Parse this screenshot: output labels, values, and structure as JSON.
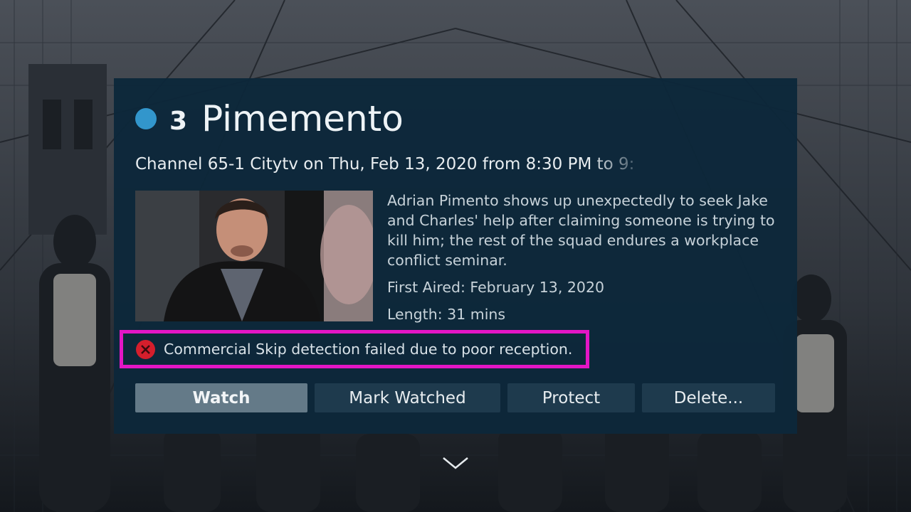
{
  "program": {
    "episode_number": "3",
    "title": "Pimemento",
    "channel_line": "Channel 65-1 Citytv on Thu, Feb 13, 2020 from 8:30 PM to 9:",
    "description": "Adrian Pimento shows up unexpectedly to seek Jake and Charles' help after claiming someone is trying to kill him; the rest of the squad endures a workplace conflict seminar.",
    "first_aired": "First Aired: February 13, 2020",
    "length": "Length: 31 mins"
  },
  "alert": {
    "icon": "error-x-icon",
    "text": "Commercial Skip detection failed due to poor reception."
  },
  "actions": {
    "watch": "Watch",
    "mark_watched": "Mark Watched",
    "protect": "Protect",
    "delete": "Delete..."
  },
  "colors": {
    "accent_dot": "#3296cc",
    "highlight_border": "#e316c5",
    "error": "#d41e2c",
    "card_bg": "#0d283a",
    "button_active": "#647a88",
    "button_default": "#1e3a4d"
  },
  "icons": {
    "status": "unwatched-dot-icon",
    "scroll_more": "chevron-down-icon"
  }
}
